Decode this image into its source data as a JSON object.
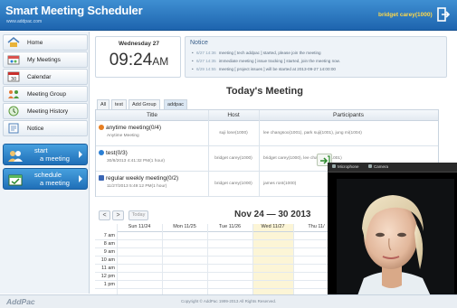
{
  "header": {
    "title": "Smart Meeting Scheduler",
    "subtitle": "www.addpac.com",
    "user": "bridget carey(1000)",
    "logout_icon": "logout-icon"
  },
  "sidebar": {
    "items": [
      {
        "label": "Home",
        "icon": "home-icon"
      },
      {
        "label": "My Meetings",
        "icon": "meetings-icon"
      },
      {
        "label": "Calendar",
        "icon": "calendar-icon"
      },
      {
        "label": "Meeting Group",
        "icon": "group-icon"
      },
      {
        "label": "Meeting History",
        "icon": "history-icon"
      },
      {
        "label": "Notice",
        "icon": "notice-icon"
      }
    ],
    "start": {
      "line1": "start",
      "line2": "a meeting"
    },
    "schedule": {
      "line1": "schedule",
      "line2": "a meeting"
    }
  },
  "clock": {
    "date": "Wednesday 27",
    "time": "09:24",
    "ampm": "AM"
  },
  "notice": {
    "title": "Notice",
    "items": [
      {
        "time": "6/27 14:36",
        "text": "meeting [ tech addpac ] started, please join the meeting"
      },
      {
        "time": "6/27 14:35",
        "text": "immediate meeting [ issue tracking ] started, join the meeting now."
      },
      {
        "time": "6/29 14:55",
        "text": "meeting [ project issues ] will be started at 2013-09-27 14:00:00"
      }
    ]
  },
  "today": {
    "title": "Today's Meeting",
    "tabs": [
      "All",
      "test",
      "Add Group",
      "addpac"
    ],
    "columns": [
      "Title",
      "Host",
      "Participants"
    ],
    "rows": [
      {
        "title": "anytime meeting(0/4)",
        "sub": "Anytime Meeting",
        "host": "suji lone(1000)",
        "participants": "lee changsoo(1001), park suji(1001), jung mi(1004)",
        "color": "#e67e22"
      },
      {
        "title": "test(0/3)",
        "sub": "30/8/2013 4:41:32 PM(1 hour)",
        "host": "bridget carey(1000)",
        "participants": "bridget carey(1000), lee changsoo(1001)",
        "color": "#2a7fd4"
      },
      {
        "title": "regular weekly meeting(0/2)",
        "sub": "11/27/2013 5:49:12 PM(1 hour)",
        "host": "bridget carey(1000)",
        "participants": "james ront(1000)",
        "color": "#3a66b5"
      }
    ]
  },
  "calendar": {
    "prev": "<",
    "next": ">",
    "today_label": "Today",
    "range": "Nov 24 — 30 2013",
    "days": [
      "Sun 11/24",
      "Mon 11/25",
      "Tue 11/26",
      "Wed 11/27",
      "Thu 11/"
    ],
    "times": [
      "7 am",
      "8 am",
      "9 am",
      "10 am",
      "11 am",
      "12 pm",
      "1 pm"
    ]
  },
  "video": {
    "mic_label": "Microphone",
    "cam_label": "Camera"
  },
  "footer": {
    "logo": "AddPac",
    "copyright": "Copyright © AddPac 1999-2013 All Rights Reserved."
  }
}
